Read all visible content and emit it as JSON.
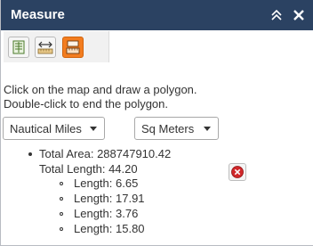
{
  "window": {
    "title": "Measure"
  },
  "tools": {
    "area": {
      "icon": "area-measure-icon"
    },
    "distance": {
      "icon": "distance-measure-icon"
    },
    "location": {
      "icon": "location-measure-icon",
      "accent": "#f37d1f"
    }
  },
  "instructions": {
    "line1": "Click on the map and draw a polygon.",
    "line2": "Double-click to end the polygon."
  },
  "units": {
    "distance_selected": "Nautical Miles",
    "area_selected": "Sq Meters"
  },
  "results": {
    "total_area_label": "Total Area:",
    "total_area_value": "288747910.42",
    "total_length_label": "Total Length:",
    "total_length_value": "44.20",
    "segments_label": "Length:",
    "segments": [
      "6.65",
      "17.91",
      "3.76",
      "15.80"
    ]
  },
  "colors": {
    "titlebar": "#2b4262",
    "accent": "#f37d1f",
    "clear_icon": "#d0272a"
  }
}
